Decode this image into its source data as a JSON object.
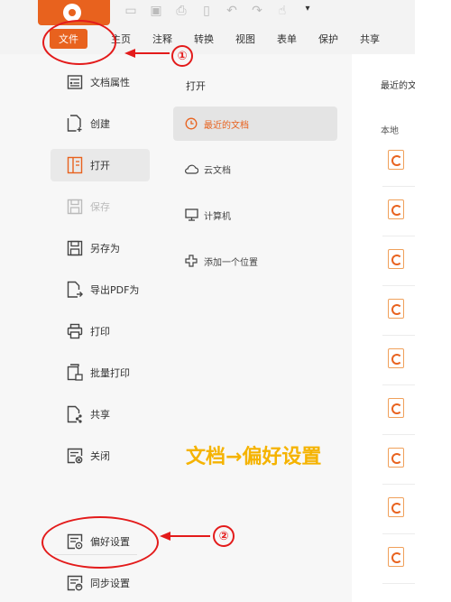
{
  "menubar": {
    "items": [
      "文件",
      "主页",
      "注释",
      "转换",
      "视图",
      "表单",
      "保护",
      "共享"
    ],
    "active": "文件"
  },
  "sidebar": {
    "items": [
      {
        "label": "文档属性",
        "icon": "document-properties-icon"
      },
      {
        "label": "创建",
        "icon": "create-document-icon"
      },
      {
        "label": "打开",
        "icon": "open-folder-icon",
        "selected": true
      },
      {
        "label": "保存",
        "icon": "save-icon",
        "disabled": true
      },
      {
        "label": "另存为",
        "icon": "save-as-icon"
      },
      {
        "label": "导出PDF为",
        "icon": "export-pdf-icon"
      },
      {
        "label": "打印",
        "icon": "printer-icon"
      },
      {
        "label": "批量打印",
        "icon": "batch-print-icon"
      },
      {
        "label": "共享",
        "icon": "share-icon"
      },
      {
        "label": "关闭",
        "icon": "close-document-icon"
      },
      {
        "label": "偏好设置",
        "icon": "preferences-icon"
      },
      {
        "label": "同步设置",
        "icon": "sync-settings-icon"
      }
    ]
  },
  "open_panel": {
    "title": "打开",
    "items": [
      {
        "label": "最近的文档",
        "icon": "clock-icon",
        "selected": true
      },
      {
        "label": "云文档",
        "icon": "cloud-icon"
      },
      {
        "label": "计算机",
        "icon": "monitor-icon"
      },
      {
        "label": "添加一个位置",
        "icon": "plus-icon"
      }
    ]
  },
  "right_panel": {
    "title": "最近的文",
    "subtitle": "本地",
    "file_count": 9
  },
  "annotations": {
    "marker1": "①",
    "marker2": "②",
    "caption": "文档→偏好设置",
    "color_red": "#e31b1b",
    "color_caption": "#f5b300"
  },
  "colors": {
    "accent": "#e8621e"
  }
}
